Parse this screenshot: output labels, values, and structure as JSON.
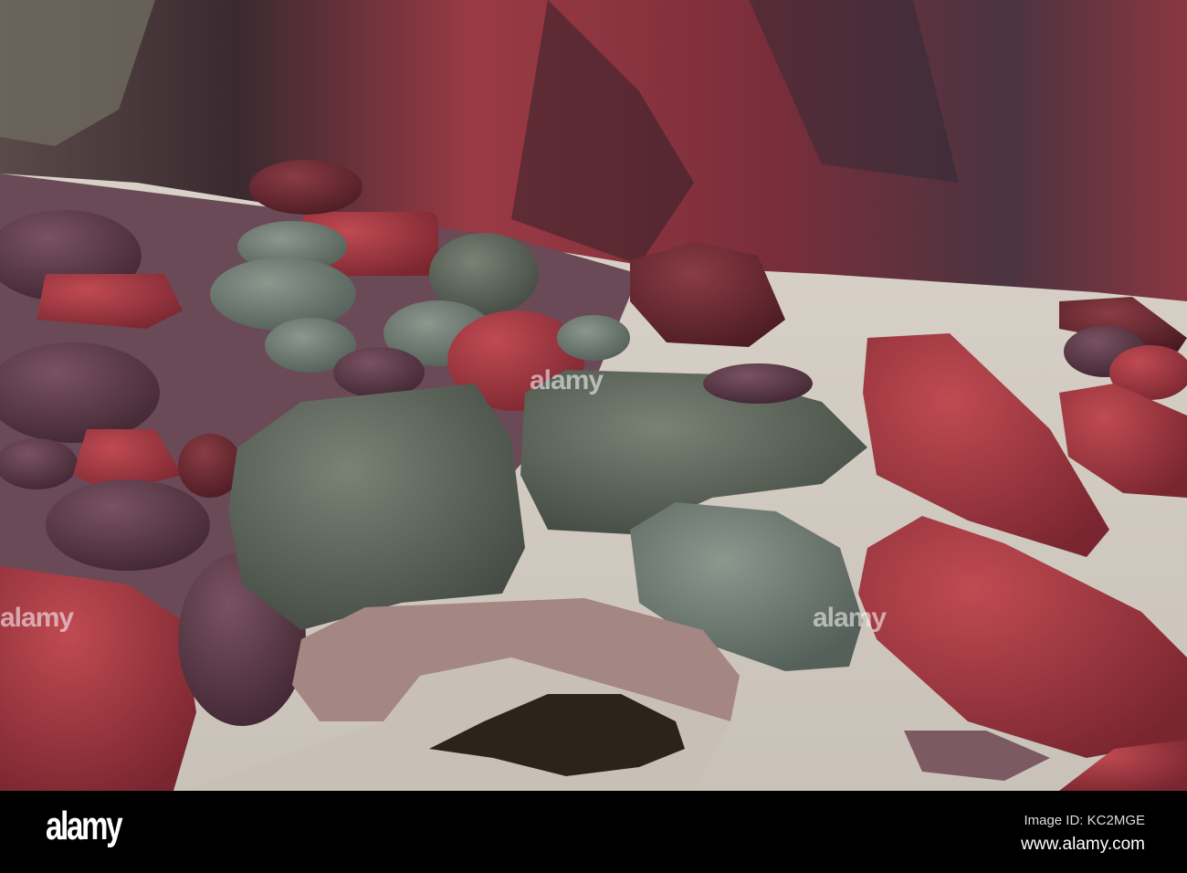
{
  "watermark": {
    "logo": "alamy",
    "overlay_text": "alamy"
  },
  "footer": {
    "logo": "alamy",
    "image_id": "Image ID: KC2MGE",
    "url": "www.alamy.com"
  }
}
